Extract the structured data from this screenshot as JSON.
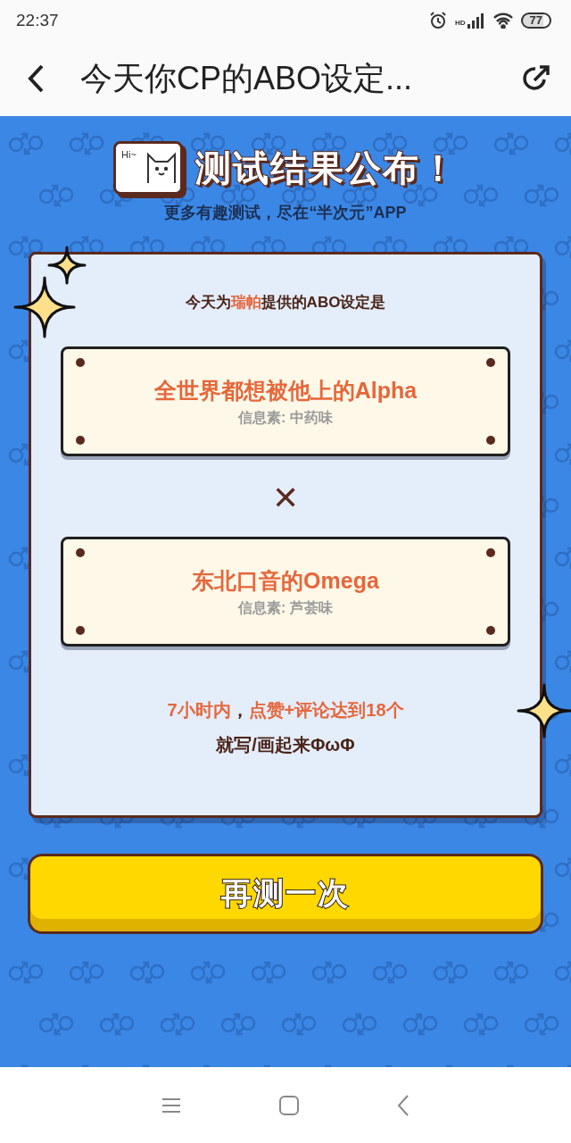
{
  "status_bar": {
    "time": "22:37",
    "network_label": "HD",
    "battery": "77"
  },
  "header": {
    "title": "今天你CP的ABO设定..."
  },
  "banner": {
    "bubble_text": "Hi~",
    "title": "测试结果公布！",
    "subtitle": "更多有趣测试，尽在“半次元”APP"
  },
  "result": {
    "intro": [
      {
        "text": "今天为",
        "highlight": false
      },
      {
        "text": "瑞帕",
        "highlight": true
      },
      {
        "text": "提供的ABO设定是",
        "highlight": false
      }
    ],
    "roles": [
      {
        "name": "全世界都想被他上的Alpha",
        "pheromone": "信息素: 中药味"
      },
      {
        "name": "东北口音的Omega",
        "pheromone": "信息素: 芦荟味"
      }
    ],
    "pair_mark": "✕",
    "challenge": [
      {
        "text": "7小时内",
        "highlight": true
      },
      {
        "text": "，",
        "highlight": false
      },
      {
        "text": "点赞+评论达到18个",
        "highlight": true
      }
    ],
    "closing": "就写/画起来ΦωΦ"
  },
  "retry_button": "再测一次"
}
